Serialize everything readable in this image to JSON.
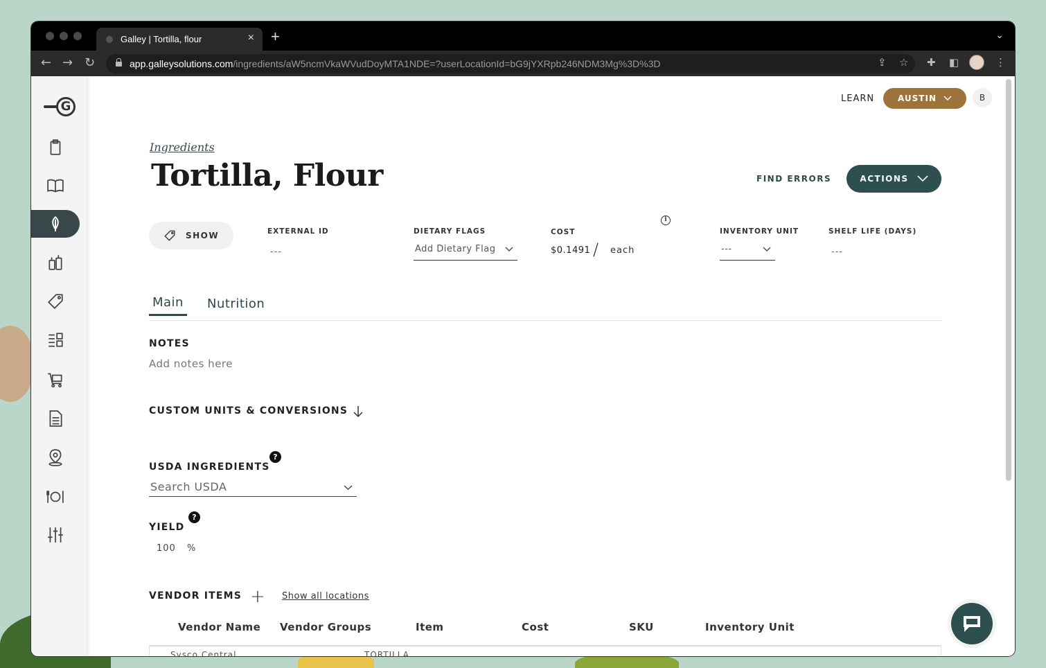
{
  "browser": {
    "tab_title": "Galley | Tortilla, flour",
    "url_host": "app.galleysolutions.com",
    "url_path": "/ingredients/aW5ncmVkaWVudDoyMTA1NDE=?userLocationId=bG9jYXRpb246NDM3Mg%3D%3D"
  },
  "header": {
    "learn_label": "LEARN",
    "location_label": "AUSTIN",
    "avatar_initial": "B"
  },
  "page": {
    "breadcrumb": "Ingredients",
    "title": "Tortilla, Flour",
    "find_errors_label": "FIND ERRORS",
    "actions_label": "ACTIONS"
  },
  "fields": {
    "show_label": "SHOW",
    "external_id_label": "EXTERNAL ID",
    "external_id_value": "---",
    "dietary_flags_label": "DIETARY FLAGS",
    "dietary_flags_placeholder": "Add Dietary Flag",
    "cost_label": "COST",
    "cost_value": "$0.1491",
    "cost_separator": "/",
    "cost_unit": "each",
    "inventory_unit_label": "INVENTORY UNIT",
    "inventory_unit_value": "---",
    "shelf_life_label": "SHELF LIFE (DAYS)",
    "shelf_life_value": "---"
  },
  "tabs": [
    {
      "label": "Main",
      "active": true
    },
    {
      "label": "Nutrition",
      "active": false
    }
  ],
  "main": {
    "notes_label": "NOTES",
    "notes_placeholder": "Add notes here",
    "custom_units_label": "CUSTOM UNITS & CONVERSIONS",
    "usda_label": "USDA INGREDIENTS",
    "usda_placeholder": "Search USDA",
    "yield_label": "YIELD",
    "yield_value": "100",
    "yield_unit": "%",
    "vendor_items_label": "VENDOR ITEMS",
    "show_all_locations": "Show all locations"
  },
  "vendor_table": {
    "headers": [
      "Vendor Name",
      "Vendor Groups",
      "Item",
      "Cost",
      "SKU",
      "Inventory Unit"
    ],
    "rows": [
      {
        "vendor_name": "Sysco Central",
        "item": "TORTILLA"
      }
    ]
  },
  "colors": {
    "accent_dark": "#2d4f4f",
    "location_brown": "#9c7339"
  }
}
